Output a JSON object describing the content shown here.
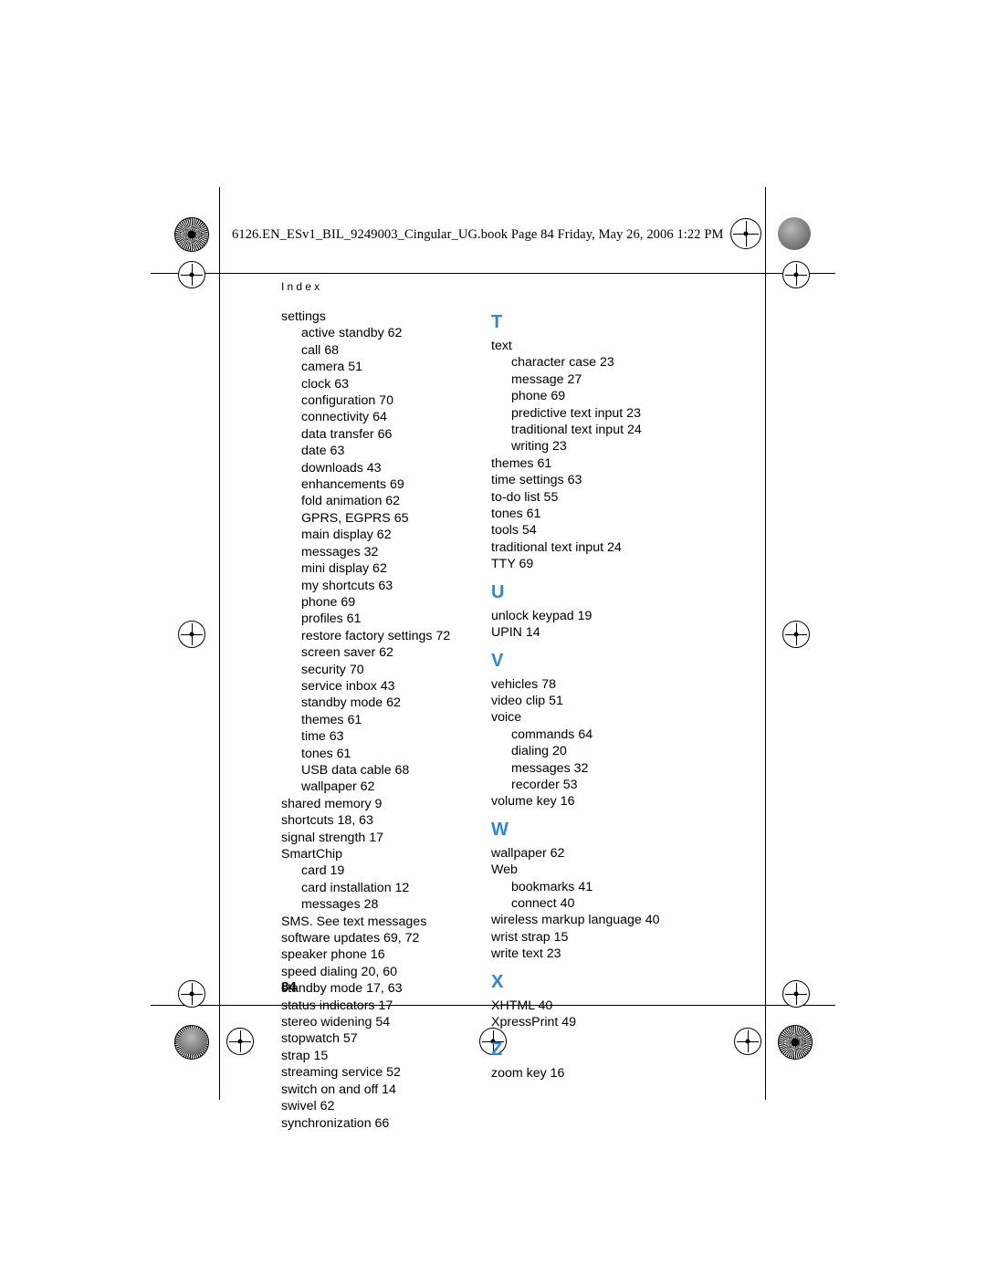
{
  "page": {
    "filestamp": "6126.EN_ESv1_BIL_9249003_Cingular_UG.book  Page 84  Friday, May 26, 2006  1:22 PM",
    "running_head": "Index",
    "page_number": "84",
    "accent_color": "#2f86d6"
  },
  "columns": [
    {
      "name": "left-column",
      "blocks": [
        {
          "letter": null,
          "entries": [
            {
              "level": 1,
              "text": "settings"
            },
            {
              "level": 2,
              "text": "active standby 62"
            },
            {
              "level": 2,
              "text": "call 68"
            },
            {
              "level": 2,
              "text": "camera 51"
            },
            {
              "level": 2,
              "text": "clock 63"
            },
            {
              "level": 2,
              "text": "configuration 70"
            },
            {
              "level": 2,
              "text": "connectivity 64"
            },
            {
              "level": 2,
              "text": "data transfer 66"
            },
            {
              "level": 2,
              "text": "date 63"
            },
            {
              "level": 2,
              "text": "downloads 43"
            },
            {
              "level": 2,
              "text": "enhancements 69"
            },
            {
              "level": 2,
              "text": "fold animation 62"
            },
            {
              "level": 2,
              "text": "GPRS, EGPRS 65"
            },
            {
              "level": 2,
              "text": "main display 62"
            },
            {
              "level": 2,
              "text": "messages 32"
            },
            {
              "level": 2,
              "text": "mini display 62"
            },
            {
              "level": 2,
              "text": "my shortcuts 63"
            },
            {
              "level": 2,
              "text": "phone 69"
            },
            {
              "level": 2,
              "text": "profiles 61"
            },
            {
              "level": 2,
              "text": "restore factory settings 72"
            },
            {
              "level": 2,
              "text": "screen saver 62"
            },
            {
              "level": 2,
              "text": "security 70"
            },
            {
              "level": 2,
              "text": "service inbox 43"
            },
            {
              "level": 2,
              "text": "standby mode 62"
            },
            {
              "level": 2,
              "text": "themes 61"
            },
            {
              "level": 2,
              "text": "time 63"
            },
            {
              "level": 2,
              "text": "tones 61"
            },
            {
              "level": 2,
              "text": "USB data cable 68"
            },
            {
              "level": 2,
              "text": "wallpaper 62"
            },
            {
              "level": 1,
              "text": "shared memory 9"
            },
            {
              "level": 1,
              "text": "shortcuts 18, 63"
            },
            {
              "level": 1,
              "text": "signal strength 17"
            },
            {
              "level": 1,
              "text": "SmartChip"
            },
            {
              "level": 2,
              "text": "card 19"
            },
            {
              "level": 2,
              "text": "card installation 12"
            },
            {
              "level": 2,
              "text": "messages 28"
            },
            {
              "level": 1,
              "text": "SMS. See text messages"
            },
            {
              "level": 1,
              "text": "software updates 69, 72"
            },
            {
              "level": 1,
              "text": "speaker phone 16"
            },
            {
              "level": 1,
              "text": "speed dialing 20, 60"
            },
            {
              "level": 1,
              "text": "standby mode 17, 63"
            },
            {
              "level": 1,
              "text": "status indicators 17"
            },
            {
              "level": 1,
              "text": "stereo widening 54"
            },
            {
              "level": 1,
              "text": "stopwatch 57"
            },
            {
              "level": 1,
              "text": "strap 15"
            },
            {
              "level": 1,
              "text": "streaming service 52"
            },
            {
              "level": 1,
              "text": "switch on and off 14"
            },
            {
              "level": 1,
              "text": "swivel 62"
            },
            {
              "level": 1,
              "text": "synchronization 66"
            }
          ]
        }
      ]
    },
    {
      "name": "right-column",
      "blocks": [
        {
          "letter": "T",
          "entries": [
            {
              "level": 1,
              "text": "text"
            },
            {
              "level": 2,
              "text": "character case 23"
            },
            {
              "level": 2,
              "text": "message 27"
            },
            {
              "level": 2,
              "text": "phone 69"
            },
            {
              "level": 2,
              "text": "predictive text input 23"
            },
            {
              "level": 2,
              "text": "traditional text input 24"
            },
            {
              "level": 2,
              "text": "writing 23"
            },
            {
              "level": 1,
              "text": "themes 61"
            },
            {
              "level": 1,
              "text": "time settings 63"
            },
            {
              "level": 1,
              "text": "to-do list 55"
            },
            {
              "level": 1,
              "text": "tones 61"
            },
            {
              "level": 1,
              "text": "tools 54"
            },
            {
              "level": 1,
              "text": "traditional text input 24"
            },
            {
              "level": 1,
              "text": "TTY 69"
            }
          ]
        },
        {
          "letter": "U",
          "entries": [
            {
              "level": 1,
              "text": "unlock keypad 19"
            },
            {
              "level": 1,
              "text": "UPIN 14"
            }
          ]
        },
        {
          "letter": "V",
          "entries": [
            {
              "level": 1,
              "text": "vehicles 78"
            },
            {
              "level": 1,
              "text": "video clip 51"
            },
            {
              "level": 1,
              "text": "voice"
            },
            {
              "level": 2,
              "text": "commands 64"
            },
            {
              "level": 2,
              "text": "dialing 20"
            },
            {
              "level": 2,
              "text": "messages 32"
            },
            {
              "level": 2,
              "text": "recorder 53"
            },
            {
              "level": 1,
              "text": "volume key 16"
            }
          ]
        },
        {
          "letter": "W",
          "entries": [
            {
              "level": 1,
              "text": "wallpaper 62"
            },
            {
              "level": 1,
              "text": "Web"
            },
            {
              "level": 2,
              "text": "bookmarks 41"
            },
            {
              "level": 2,
              "text": "connect 40"
            },
            {
              "level": 1,
              "text": "wireless markup language 40"
            },
            {
              "level": 1,
              "text": "wrist strap 15"
            },
            {
              "level": 1,
              "text": "write text 23"
            }
          ]
        },
        {
          "letter": "X",
          "entries": [
            {
              "level": 1,
              "text": "XHTML 40"
            },
            {
              "level": 1,
              "text": "XpressPrint 49"
            }
          ]
        },
        {
          "letter": "Z",
          "entries": [
            {
              "level": 1,
              "text": "zoom key 16"
            }
          ]
        }
      ]
    }
  ]
}
